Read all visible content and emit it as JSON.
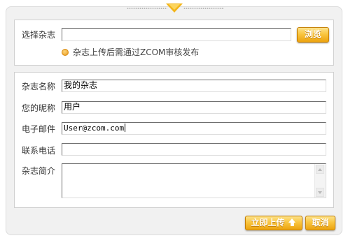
{
  "upload": {
    "select_label": "选择杂志",
    "file_value": "",
    "browse_label": "浏览",
    "note": "杂志上传后需通过ZCOM审核发布"
  },
  "form": {
    "name_label": "杂志名称",
    "name_value": "我的杂志",
    "nickname_label": "您的昵称",
    "nickname_value": "用户",
    "email_label": "电子邮件",
    "email_value": "User@zcom.com",
    "phone_label": "联系电话",
    "phone_value": "",
    "intro_label": "杂志简介",
    "intro_value": ""
  },
  "actions": {
    "upload_label": "立即上传",
    "cancel_label": "取消"
  },
  "colors": {
    "accent": "#f3b51a",
    "button_border": "#c57e00"
  }
}
